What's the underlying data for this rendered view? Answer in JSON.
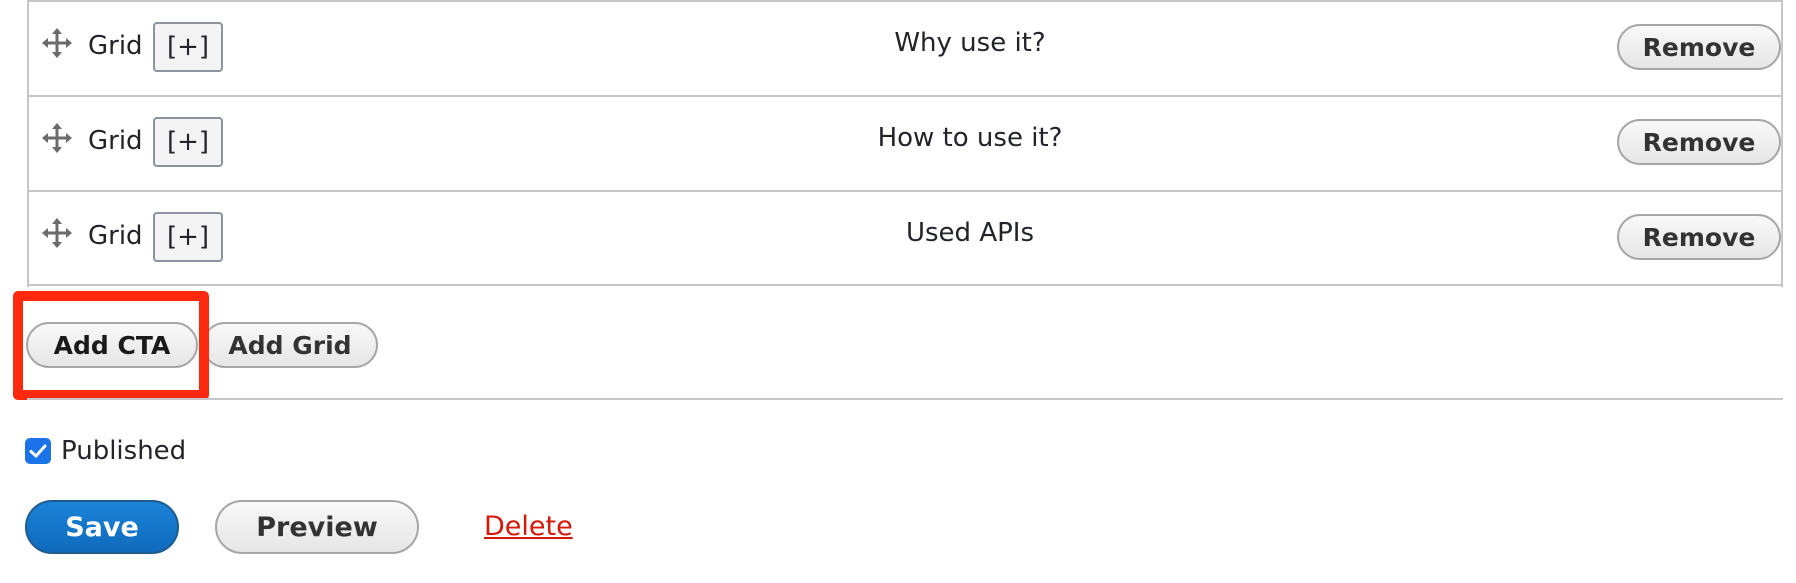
{
  "rows": [
    {
      "type": "Grid",
      "expand_label": "[+]",
      "title": "Why use it?",
      "remove_label": "Remove"
    },
    {
      "type": "Grid",
      "expand_label": "[+]",
      "title": "How to use it?",
      "remove_label": "Remove"
    },
    {
      "type": "Grid",
      "expand_label": "[+]",
      "title": "Used APIs",
      "remove_label": "Remove"
    }
  ],
  "add_buttons": {
    "add_cta": "Add CTA",
    "add_grid": "Add Grid"
  },
  "published": {
    "label": "Published",
    "checked": true
  },
  "actions": {
    "save": "Save",
    "preview": "Preview",
    "delete": "Delete"
  },
  "colors": {
    "highlight": "#ff2a0d",
    "primary": "#0f6abd",
    "danger": "#d4180a",
    "checkbox": "#1a73e8"
  }
}
